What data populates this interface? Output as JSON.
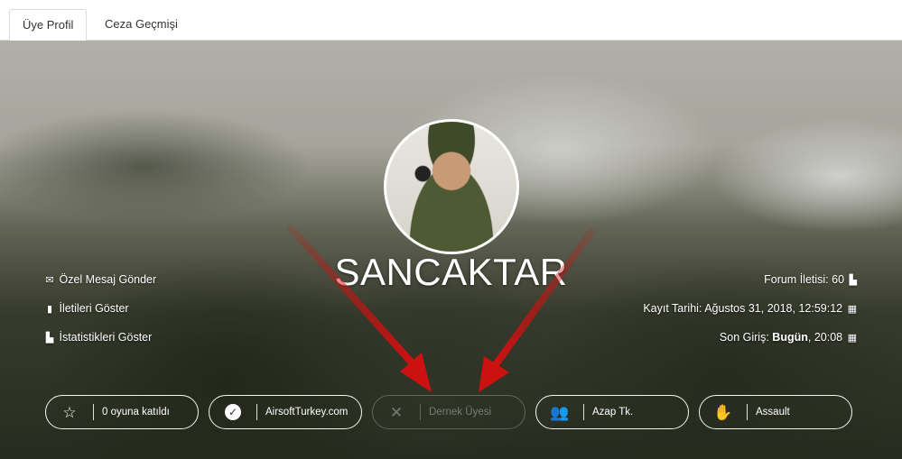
{
  "tabs": [
    {
      "label": "Üye Profil",
      "active": true
    },
    {
      "label": "Ceza Geçmişi",
      "active": false
    }
  ],
  "profile": {
    "username": "SANCAKTAR"
  },
  "actions": [
    {
      "label": "Özel Mesaj Gönder",
      "icon": "envelope-icon"
    },
    {
      "label": "İletileri Göster",
      "icon": "file-icon"
    },
    {
      "label": "İstatistikleri Göster",
      "icon": "chart-icon"
    }
  ],
  "stats": {
    "forum_posts_label": "Forum İletisi:",
    "forum_posts_value": "60",
    "registered_label": "Kayıt Tarihi:",
    "registered_value": "Ağustos 31, 2018, 12:59:12",
    "last_login_label": "Son Giriş:",
    "last_login_day": "Bugün",
    "last_login_time": ", 20:08"
  },
  "badges": [
    {
      "label": "0 oyuna katıldı",
      "icon": "star-icon",
      "active": true
    },
    {
      "label": "AirsoftTurkey.com",
      "icon": "check-circle-icon",
      "active": true
    },
    {
      "label": "Dernek Üyesi",
      "icon": "times-icon",
      "active": false
    },
    {
      "label": "Azap Tk.",
      "icon": "users-icon",
      "active": true
    },
    {
      "label": "Assault",
      "icon": "hand-icon",
      "active": true
    }
  ],
  "colors": {
    "annotation_arrow": "#cc1111"
  }
}
